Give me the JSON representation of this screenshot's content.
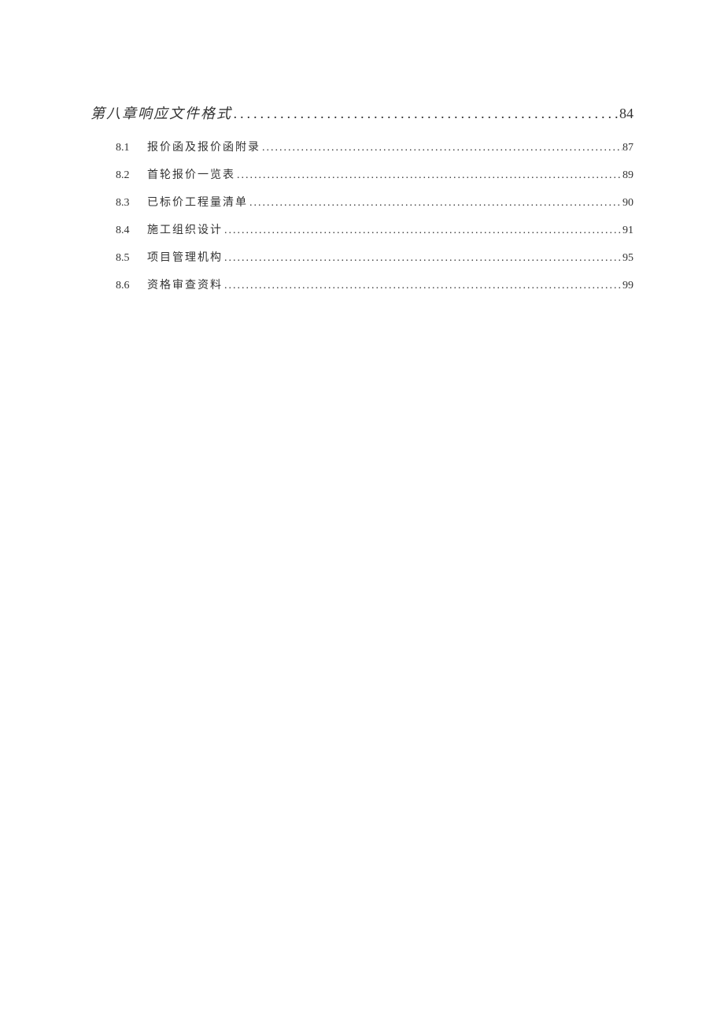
{
  "chapter": {
    "title": "第八章响应文件格式",
    "page": "84"
  },
  "subsections": [
    {
      "num": "8.1",
      "title": "报价函及报价函附录",
      "page": "87"
    },
    {
      "num": "8.2",
      "title": "首轮报价一览表",
      "page": "89"
    },
    {
      "num": "8.3",
      "title": "已标价工程量清单",
      "page": "90"
    },
    {
      "num": "8.4",
      "title": "施工组织设计",
      "page": "91"
    },
    {
      "num": "8.5",
      "title": "项目管理机构",
      "page": "95"
    },
    {
      "num": "8.6",
      "title": "资格审查资料",
      "page": "99"
    }
  ],
  "dots": "................................................................................................................"
}
